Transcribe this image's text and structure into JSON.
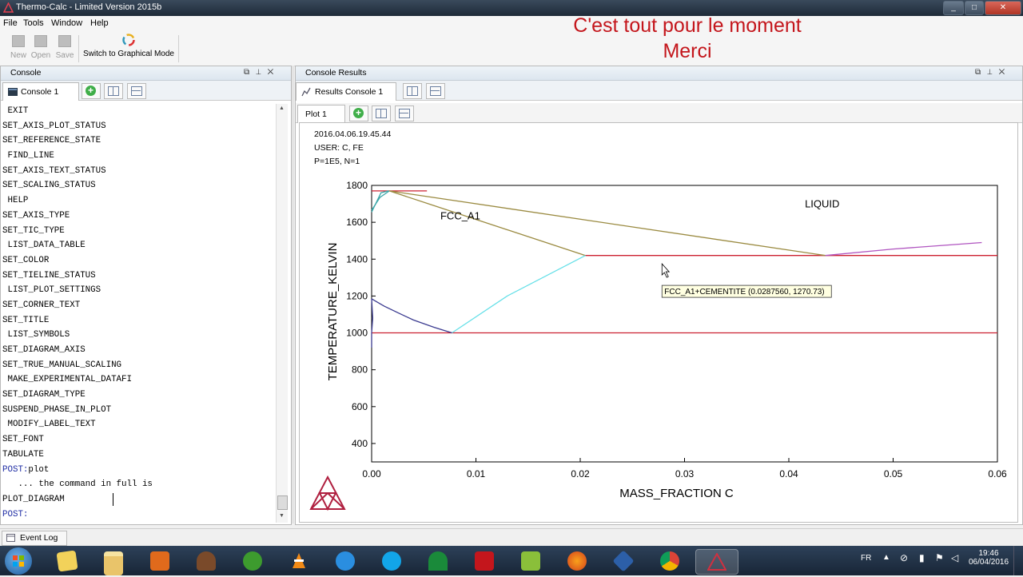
{
  "window": {
    "title": "Thermo-Calc - Limited Version 2015b",
    "controls": [
      "_",
      "□",
      "✕"
    ]
  },
  "menu": [
    "File",
    "Tools",
    "Window",
    "Help"
  ],
  "overlay": {
    "line1": "C'est tout pour le moment",
    "line2": "Merci"
  },
  "toolbar": {
    "new": "New",
    "open": "Open",
    "save": "Save",
    "graphical": "Switch to Graphical Mode"
  },
  "console_panel": {
    "title": "Console",
    "tab": "Console 1",
    "lines": [
      {
        "text": " EXIT",
        "prompt": false
      },
      {
        "text": "SET_AXIS_PLOT_STATUS",
        "prompt": false
      },
      {
        "text": "SET_REFERENCE_STATE",
        "prompt": false
      },
      {
        "text": " FIND_LINE",
        "prompt": false
      },
      {
        "text": "SET_AXIS_TEXT_STATUS",
        "prompt": false
      },
      {
        "text": "SET_SCALING_STATUS",
        "prompt": false
      },
      {
        "text": " HELP",
        "prompt": false
      },
      {
        "text": "SET_AXIS_TYPE",
        "prompt": false
      },
      {
        "text": "SET_TIC_TYPE",
        "prompt": false
      },
      {
        "text": " LIST_DATA_TABLE",
        "prompt": false
      },
      {
        "text": "SET_COLOR",
        "prompt": false
      },
      {
        "text": "SET_TIELINE_STATUS",
        "prompt": false
      },
      {
        "text": " LIST_PLOT_SETTINGS",
        "prompt": false
      },
      {
        "text": "SET_CORNER_TEXT",
        "prompt": false
      },
      {
        "text": "SET_TITLE",
        "prompt": false
      },
      {
        "text": " LIST_SYMBOLS",
        "prompt": false
      },
      {
        "text": "SET_DIAGRAM_AXIS",
        "prompt": false
      },
      {
        "text": "SET_TRUE_MANUAL_SCALING",
        "prompt": false
      },
      {
        "text": " MAKE_EXPERIMENTAL_DATAFI",
        "prompt": false
      },
      {
        "text": "SET_DIAGRAM_TYPE",
        "prompt": false
      },
      {
        "text": "SUSPEND_PHASE_IN_PLOT",
        "prompt": false
      },
      {
        "text": " MODIFY_LABEL_TEXT",
        "prompt": false
      },
      {
        "text": "SET_FONT",
        "prompt": false
      },
      {
        "text": "TABULATE",
        "prompt": false
      },
      {
        "text": "POST:",
        "prompt": true,
        "cmd": "plot"
      },
      {
        "text": "   ... the command in full is",
        "prompt": false
      },
      {
        "text": "PLOT_DIAGRAM",
        "prompt": false
      },
      {
        "text": "POST:",
        "prompt": true,
        "cmd": ""
      }
    ]
  },
  "results_panel": {
    "title": "Console Results",
    "tab": "Results Console 1",
    "plot_tab": "Plot 1",
    "corner_text": [
      "2016.04.06.19.45.44",
      "USER: C, FE",
      "P=1E5, N=1"
    ]
  },
  "chart_data": {
    "type": "line",
    "xlabel": "MASS_FRACTION C",
    "ylabel": "TEMPERATURE_KELVIN",
    "xlim": [
      0,
      0.06
    ],
    "ylim": [
      300,
      1800
    ],
    "xticks": [
      "0.00",
      "0.01",
      "0.02",
      "0.03",
      "0.04",
      "0.05",
      "0.06"
    ],
    "yticks": [
      "400",
      "600",
      "800",
      "1000",
      "1200",
      "1400",
      "1600",
      "1800"
    ],
    "region_labels": [
      {
        "text": "FCC_A1",
        "x": 0.0085,
        "y": 1615
      },
      {
        "text": "LIQUID",
        "x": 0.0432,
        "y": 1680
      }
    ],
    "tooltip": {
      "text": "FCC_A1+CEMENTITE (0.0287560, 1270.73)",
      "x": 0.028756,
      "y": 1270.73
    },
    "series": [
      {
        "color": "#cc2030",
        "points": [
          [
            0.0,
            1770
          ],
          [
            0.0053,
            1770
          ]
        ]
      },
      {
        "color": "#cc2030",
        "points": [
          [
            0.0205,
            1420
          ],
          [
            0.06,
            1420
          ]
        ]
      },
      {
        "color": "#cc2030",
        "points": [
          [
            0.0,
            1000
          ],
          [
            0.06,
            1000
          ]
        ]
      },
      {
        "color": "#3aa6a8",
        "points": [
          [
            0.0,
            1665
          ],
          [
            0.0008,
            1735
          ],
          [
            0.0017,
            1770
          ]
        ]
      },
      {
        "color": "#3aa6a8",
        "points": [
          [
            0.0,
            1655
          ],
          [
            0.0009,
            1760
          ],
          [
            0.0016,
            1770
          ]
        ]
      },
      {
        "color": "#9a8a40",
        "points": [
          [
            0.0017,
            1770
          ],
          [
            0.0205,
            1420
          ]
        ]
      },
      {
        "color": "#9a8a40",
        "points": [
          [
            0.0017,
            1770
          ],
          [
            0.0435,
            1420
          ]
        ]
      },
      {
        "color": "#b055c0",
        "points": [
          [
            0.0435,
            1420
          ],
          [
            0.05,
            1455
          ],
          [
            0.0585,
            1490
          ]
        ]
      },
      {
        "color": "#66e0e8",
        "points": [
          [
            0.0077,
            1000
          ],
          [
            0.013,
            1200
          ],
          [
            0.0205,
            1420
          ]
        ]
      },
      {
        "color": "#3b3b90",
        "points": [
          [
            0.0,
            1185
          ],
          [
            0.0012,
            1145
          ],
          [
            0.0025,
            1110
          ],
          [
            0.004,
            1070
          ],
          [
            0.006,
            1030
          ],
          [
            0.0077,
            1000
          ]
        ]
      },
      {
        "color": "#3b3b90",
        "points": [
          [
            0.0,
            1185
          ],
          [
            0.0001,
            1080
          ],
          [
            0.0,
            1000
          ],
          [
            0.0,
            920
          ]
        ]
      }
    ]
  },
  "eventbar": {
    "label": "Event Log"
  },
  "tray": {
    "lang": "FR",
    "time": "19:46",
    "date": "06/04/2016"
  }
}
